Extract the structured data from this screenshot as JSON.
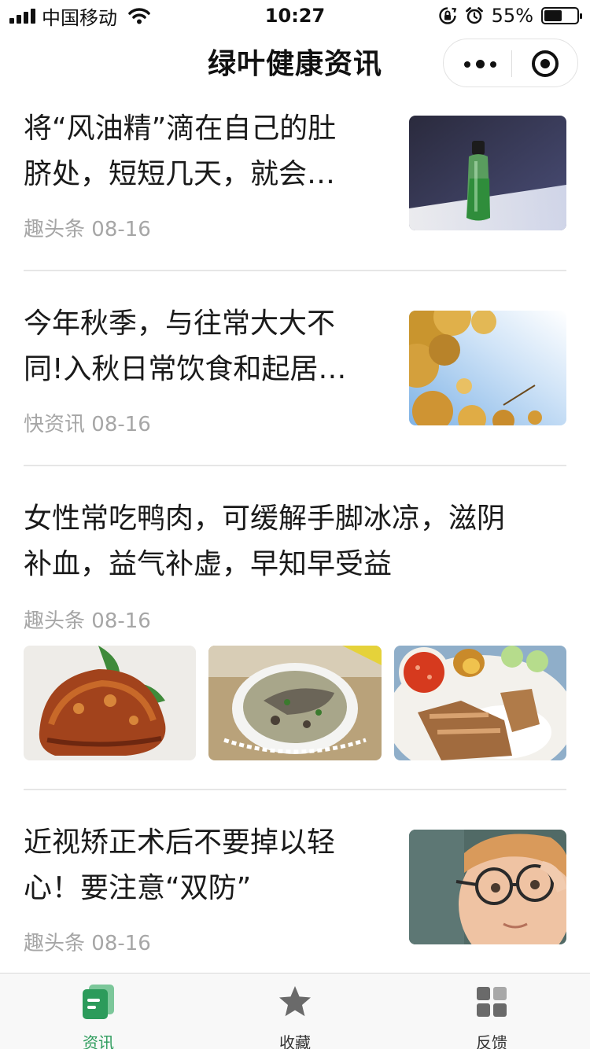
{
  "status_bar": {
    "carrier": "中国移动",
    "time": "10:27",
    "battery_text": "55%",
    "battery_level": 0.55
  },
  "nav": {
    "title": "绿叶健康资讯"
  },
  "articles": [
    {
      "title_lines": [
        "将“风油精”滴在自己的肚",
        "脐处，短短几天，就会…"
      ],
      "source": "趣头条",
      "date": "08-16",
      "thumb": "green-oil-bottle"
    },
    {
      "title_lines": [
        "今年秋季，与往常大大不",
        "同!入秋日常饮食和起居…"
      ],
      "source": "快资讯",
      "date": "08-16",
      "thumb": "autumn-leaves-sky"
    },
    {
      "title_lines": [
        "女性常吃鸭肉，可缓解手脚冰凉，滋阴",
        "补血，益气补虚，早知早受益"
      ],
      "source": "趣头条",
      "date": "08-16",
      "thumbs": [
        "roast-duck",
        "duck-soup",
        "duck-rice-plate"
      ]
    },
    {
      "title_lines": [
        "近视矫正术后不要掉以轻",
        "心！要注意“双防”"
      ],
      "source": "趣头条",
      "date": "08-16",
      "thumb": "boy-with-glasses"
    }
  ],
  "tabbar": {
    "items": [
      {
        "label": "资讯",
        "icon": "news-icon",
        "active": true
      },
      {
        "label": "收藏",
        "icon": "star-icon",
        "active": false
      },
      {
        "label": "反馈",
        "icon": "grid-icon",
        "active": false
      }
    ]
  },
  "colors": {
    "accent": "#2c9b5b",
    "meta_gray": "#a6a6a6",
    "divider": "#e6e6e6"
  }
}
